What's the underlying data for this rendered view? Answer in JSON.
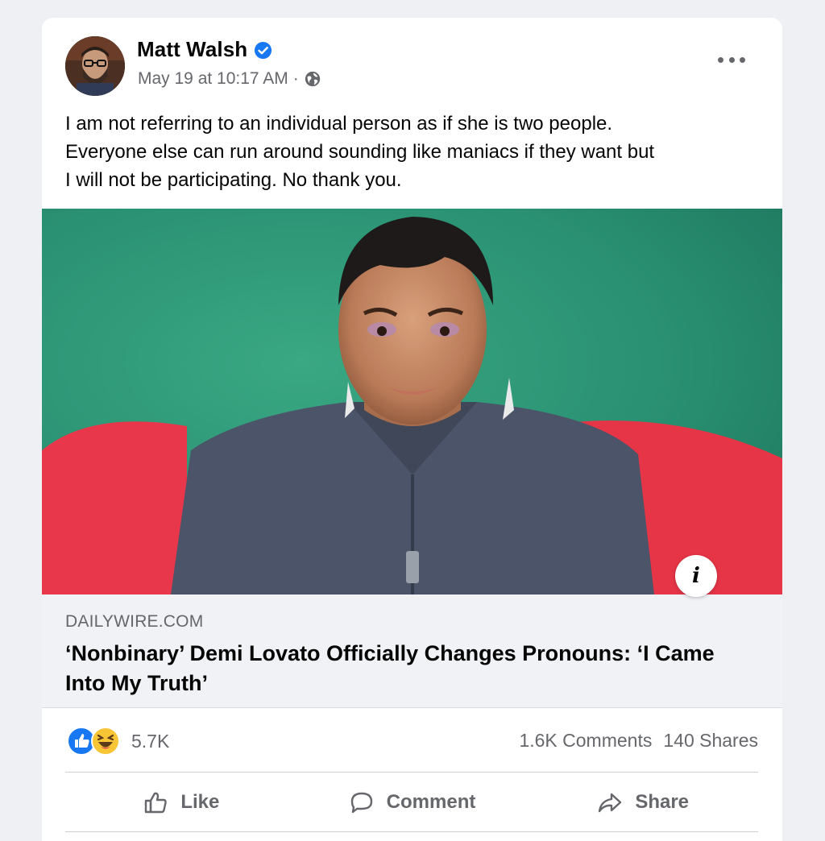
{
  "post": {
    "author": "Matt Walsh",
    "timestamp": "May 19 at 10:17 AM",
    "separator": "·",
    "audience_icon": "globe-icon",
    "verified_icon": "verified-badge-icon",
    "text": "I am not referring to an individual person as if she is two people.\nEveryone else can run around sounding like maniacs if they want but\nI will not be participating. No thank you."
  },
  "link_preview": {
    "domain": "DAILYWIRE.COM",
    "headline": "‘Nonbinary’ Demi Lovato Officially Changes Pronouns: ‘I Came Into My Truth’",
    "info_label": "i"
  },
  "engagement": {
    "reactions_count": "5.7K",
    "reaction_icons": [
      "like-reaction-icon",
      "haha-reaction-icon"
    ],
    "comments": "1.6K Comments",
    "shares": "140 Shares"
  },
  "actions": {
    "like": "Like",
    "comment": "Comment",
    "share": "Share"
  },
  "colors": {
    "background": "#eef0f3",
    "card": "#ffffff",
    "secondary_text": "#65676b",
    "verified_blue": "#1877f2",
    "link_meta_bg": "#f0f2f5"
  }
}
